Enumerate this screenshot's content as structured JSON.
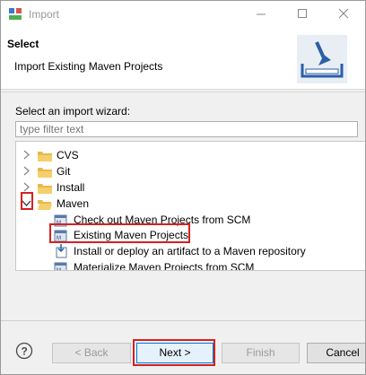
{
  "window": {
    "title": "Import"
  },
  "header": {
    "title": "Select",
    "description": "Import Existing Maven Projects"
  },
  "wizard": {
    "label": "Select an import wizard:",
    "filter_placeholder": "type filter text",
    "tree": [
      {
        "label": "CVS",
        "type": "folder",
        "expanded": false
      },
      {
        "label": "Git",
        "type": "folder",
        "expanded": false
      },
      {
        "label": "Install",
        "type": "folder",
        "expanded": false
      },
      {
        "label": "Maven",
        "type": "folder",
        "expanded": true
      },
      {
        "label": "Check out Maven Projects from SCM",
        "type": "wizard"
      },
      {
        "label": "Existing Maven Projects",
        "type": "wizard",
        "selected": true
      },
      {
        "label": "Install or deploy an artifact to a Maven repository",
        "type": "wizard"
      },
      {
        "label": "Materialize Maven Projects from SCM",
        "type": "wizard"
      }
    ]
  },
  "buttons": {
    "back": "< Back",
    "next": "Next >",
    "finish": "Finish",
    "cancel": "Cancel"
  },
  "icons": {
    "app": "eclipse-import-icon",
    "help": "help-icon",
    "banner": "import-wizard-banner-icon",
    "folder": "folder-icon",
    "wizard": "maven-project-icon"
  },
  "colors": {
    "highlight": "#d62020",
    "folder": "#e8b84a",
    "accent": "#0078d7"
  }
}
